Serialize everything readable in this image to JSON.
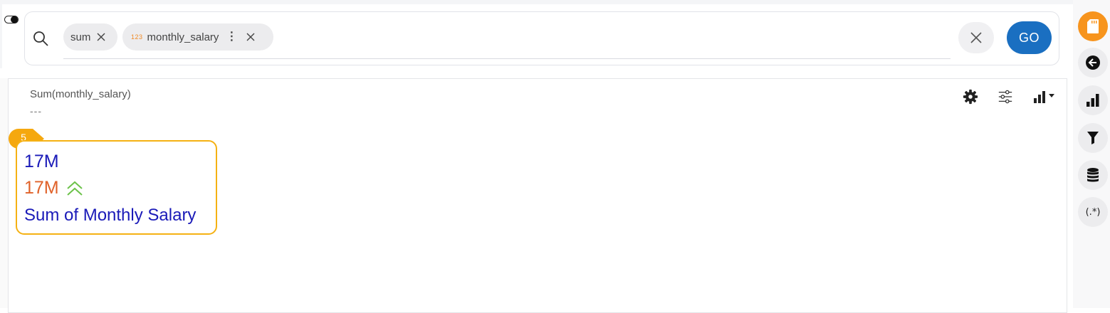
{
  "search": {
    "chips": [
      {
        "label": "sum"
      },
      {
        "type_badge": "123",
        "label": "monthly_salary"
      }
    ],
    "go_label": "GO"
  },
  "panel": {
    "title": "Sum(monthly_salary)",
    "subtitle": "---"
  },
  "kpi": {
    "badge": "5",
    "value": "17M",
    "compare_value": "17M",
    "trend": "up",
    "label": "Sum of Monthly Salary",
    "colors": {
      "value": "#1a1ab8",
      "compare": "#e0622a",
      "trend": "#6cc24a",
      "border": "#f5b113"
    }
  },
  "sidebar": {
    "items": [
      {
        "icon": "sd-card-icon",
        "active": true
      },
      {
        "icon": "back-arrow-icon"
      },
      {
        "icon": "bar-chart-icon"
      },
      {
        "icon": "filter-icon"
      },
      {
        "icon": "database-icon"
      },
      {
        "icon": "regex-icon",
        "text": "(.*)"
      }
    ]
  },
  "colors": {
    "accent": "#1a6fc1",
    "sidebar_active": "#f7941d"
  }
}
